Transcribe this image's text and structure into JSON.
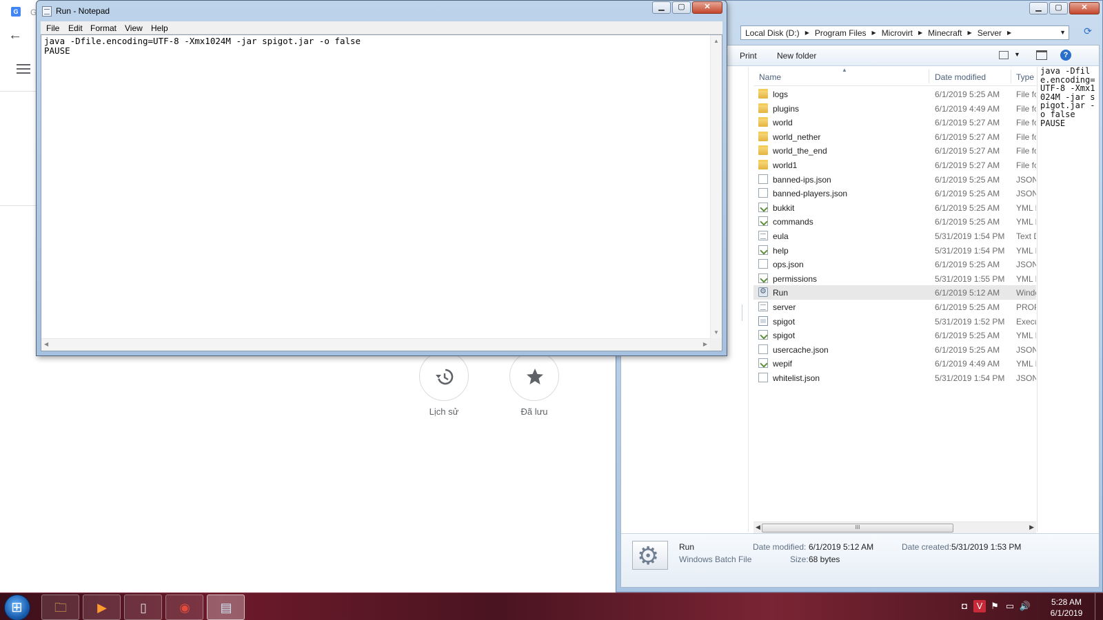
{
  "browser": {
    "history_label": "Lịch sử",
    "saved_label": "Đã lưu",
    "tab_letter": "G"
  },
  "explorer": {
    "breadcrumb": [
      "Local Disk (D:)",
      "Program Files",
      "Microvirt",
      "Minecraft",
      "Server"
    ],
    "toolbar": {
      "print": "Print",
      "new_folder": "New folder"
    },
    "columns": {
      "name": "Name",
      "date": "Date modified",
      "type": "Type"
    },
    "files": [
      {
        "name": "logs",
        "date": "6/1/2019 5:25 AM",
        "type": "File fo",
        "icon": "folder"
      },
      {
        "name": "plugins",
        "date": "6/1/2019 4:49 AM",
        "type": "File fo",
        "icon": "folder"
      },
      {
        "name": "world",
        "date": "6/1/2019 5:27 AM",
        "type": "File fo",
        "icon": "folder"
      },
      {
        "name": "world_nether",
        "date": "6/1/2019 5:27 AM",
        "type": "File fo",
        "icon": "folder"
      },
      {
        "name": "world_the_end",
        "date": "6/1/2019 5:27 AM",
        "type": "File fo",
        "icon": "folder"
      },
      {
        "name": "world1",
        "date": "6/1/2019 5:27 AM",
        "type": "File fo",
        "icon": "folder"
      },
      {
        "name": "banned-ips.json",
        "date": "6/1/2019 5:25 AM",
        "type": "JSON I",
        "icon": "doc"
      },
      {
        "name": "banned-players.json",
        "date": "6/1/2019 5:25 AM",
        "type": "JSON I",
        "icon": "doc"
      },
      {
        "name": "bukkit",
        "date": "6/1/2019 5:25 AM",
        "type": "YML F",
        "icon": "yml"
      },
      {
        "name": "commands",
        "date": "6/1/2019 5:25 AM",
        "type": "YML F",
        "icon": "yml"
      },
      {
        "name": "eula",
        "date": "5/31/2019 1:54 PM",
        "type": "Text D",
        "icon": "txt"
      },
      {
        "name": "help",
        "date": "5/31/2019 1:54 PM",
        "type": "YML F",
        "icon": "yml"
      },
      {
        "name": "ops.json",
        "date": "6/1/2019 5:25 AM",
        "type": "JSON I",
        "icon": "doc"
      },
      {
        "name": "permissions",
        "date": "5/31/2019 1:55 PM",
        "type": "YML F",
        "icon": "yml"
      },
      {
        "name": "Run",
        "date": "6/1/2019 5:12 AM",
        "type": "Windc",
        "icon": "bat",
        "selected": true
      },
      {
        "name": "server",
        "date": "6/1/2019 5:25 AM",
        "type": "PROPE",
        "icon": "txt"
      },
      {
        "name": "spigot",
        "date": "5/31/2019 1:52 PM",
        "type": "Execut",
        "icon": "jar"
      },
      {
        "name": "spigot",
        "date": "6/1/2019 5:25 AM",
        "type": "YML F",
        "icon": "yml"
      },
      {
        "name": "usercache.json",
        "date": "6/1/2019 5:25 AM",
        "type": "JSON I",
        "icon": "doc"
      },
      {
        "name": "wepif",
        "date": "6/1/2019 4:49 AM",
        "type": "YML F",
        "icon": "yml"
      },
      {
        "name": "whitelist.json",
        "date": "5/31/2019 1:54 PM",
        "type": "JSON I",
        "icon": "doc"
      }
    ],
    "preview_text": "java -Dfile.encoding=UTF-8 -Xmx1024M -jar spigot.jar -o false\nPAUSE",
    "details": {
      "name": "Run",
      "kind": "Windows Batch File",
      "modified_label": "Date modified:",
      "modified_value": "6/1/2019 5:12 AM",
      "size_label": "Size:",
      "size_value": "68 bytes",
      "created_label": "Date created:",
      "created_value": "5/31/2019 1:53 PM"
    }
  },
  "notepad": {
    "title": "Run - Notepad",
    "menu": [
      "File",
      "Edit",
      "Format",
      "View",
      "Help"
    ],
    "content": "java -Dfile.encoding=UTF-8 -Xmx1024M -jar spigot.jar -o false\nPAUSE"
  },
  "taskbar": {
    "time": "5:28 AM",
    "date": "6/1/2019"
  }
}
